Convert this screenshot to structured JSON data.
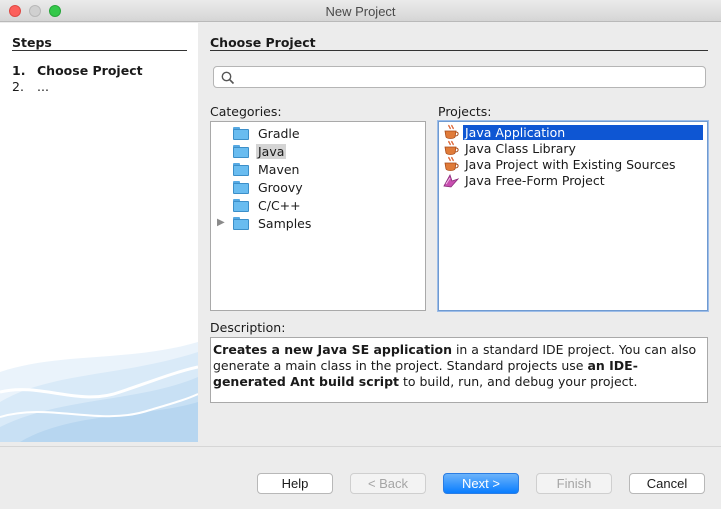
{
  "window": {
    "title": "New Project"
  },
  "steps": {
    "heading": "Steps",
    "items": [
      {
        "num": "1.",
        "label": "Choose Project"
      },
      {
        "num": "2.",
        "label": "..."
      }
    ]
  },
  "main": {
    "heading": "Choose Project",
    "search": {
      "value": "",
      "placeholder": ""
    },
    "categories_label": "Categories:",
    "categories": [
      {
        "label": "Gradle",
        "expandable": false,
        "selected": false
      },
      {
        "label": "Java",
        "expandable": false,
        "selected": true
      },
      {
        "label": "Maven",
        "expandable": false,
        "selected": false
      },
      {
        "label": "Groovy",
        "expandable": false,
        "selected": false
      },
      {
        "label": "C/C++",
        "expandable": false,
        "selected": false
      },
      {
        "label": "Samples",
        "expandable": true,
        "selected": false
      }
    ],
    "projects_label": "Projects:",
    "projects": [
      {
        "label": "Java Application",
        "icon": "java-cup-icon",
        "selected": true
      },
      {
        "label": "Java Class Library",
        "icon": "java-cup-icon",
        "selected": false
      },
      {
        "label": "Java Project with Existing Sources",
        "icon": "java-cup-icon",
        "selected": false
      },
      {
        "label": "Java Free-Form Project",
        "icon": "free-form-project-icon",
        "selected": false
      }
    ],
    "description_label": "Description:",
    "description": {
      "p1": "Creates a new Java SE application",
      "p2": " in a standard IDE project. You can also generate a main class in the project. Standard projects use ",
      "p3": "an IDE-generated Ant build script",
      "p4": " to build, run, and debug your project."
    }
  },
  "buttons": {
    "help": "Help",
    "back": "< Back",
    "next": "Next >",
    "finish": "Finish",
    "cancel": "Cancel"
  },
  "colors": {
    "selection": "#0e56d3",
    "primary_button": "#097dff",
    "folder": "#69bcf0"
  }
}
